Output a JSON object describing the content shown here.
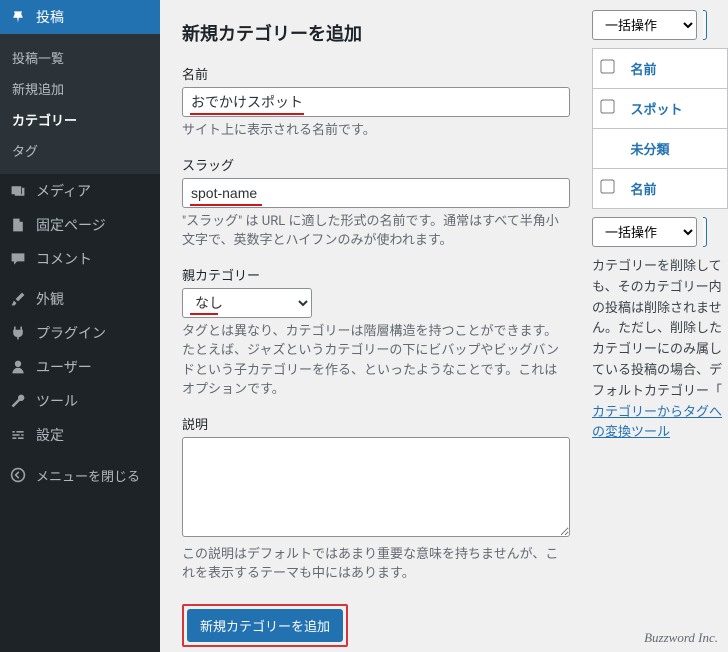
{
  "sidebar": {
    "posts": {
      "label": "投稿"
    },
    "posts_sub": {
      "list": "投稿一覧",
      "new": "新規追加",
      "categories": "カテゴリー",
      "tags": "タグ"
    },
    "media": "メディア",
    "pages": "固定ページ",
    "comments": "コメント",
    "appearance": "外観",
    "plugins": "プラグイン",
    "users": "ユーザー",
    "tools": "ツール",
    "settings": "設定",
    "collapse": "メニューを閉じる"
  },
  "form": {
    "heading": "新規カテゴリーを追加",
    "name_label": "名前",
    "name_value": "おでかけスポット",
    "name_help": "サイト上に表示される名前です。",
    "slug_label": "スラッグ",
    "slug_value": "spot-name",
    "slug_help": "\"スラッグ\" は URL に適した形式の名前です。通常はすべて半角小文字で、英数字とハイフンのみが使われます。",
    "parent_label": "親カテゴリー",
    "parent_selected": "なし",
    "parent_help": "タグとは異なり、カテゴリーは階層構造を持つことができます。たとえば、ジャズというカテゴリーの下にビバップやビッグバンドという子カテゴリーを作る、といったようなことです。これはオプションです。",
    "desc_label": "説明",
    "desc_value": "",
    "desc_help": "この説明はデフォルトではあまり重要な意味を持ちませんが、これを表示するテーマも中にはあります。",
    "submit": "新規カテゴリーを追加"
  },
  "table": {
    "bulk": "一括操作",
    "col_name": "名前",
    "rows": {
      "spot": "スポット",
      "uncat": "未分類"
    },
    "delete_note_1": "カテゴリーを削除しても、そのカテゴリー内の投稿は削除されません。ただし、削除したカテゴリーにのみ属している投稿の場合、デフォルトカテゴリー「",
    "delete_note_link": "カテゴリーからタグへの変換ツール"
  },
  "footer": "Buzzword Inc."
}
